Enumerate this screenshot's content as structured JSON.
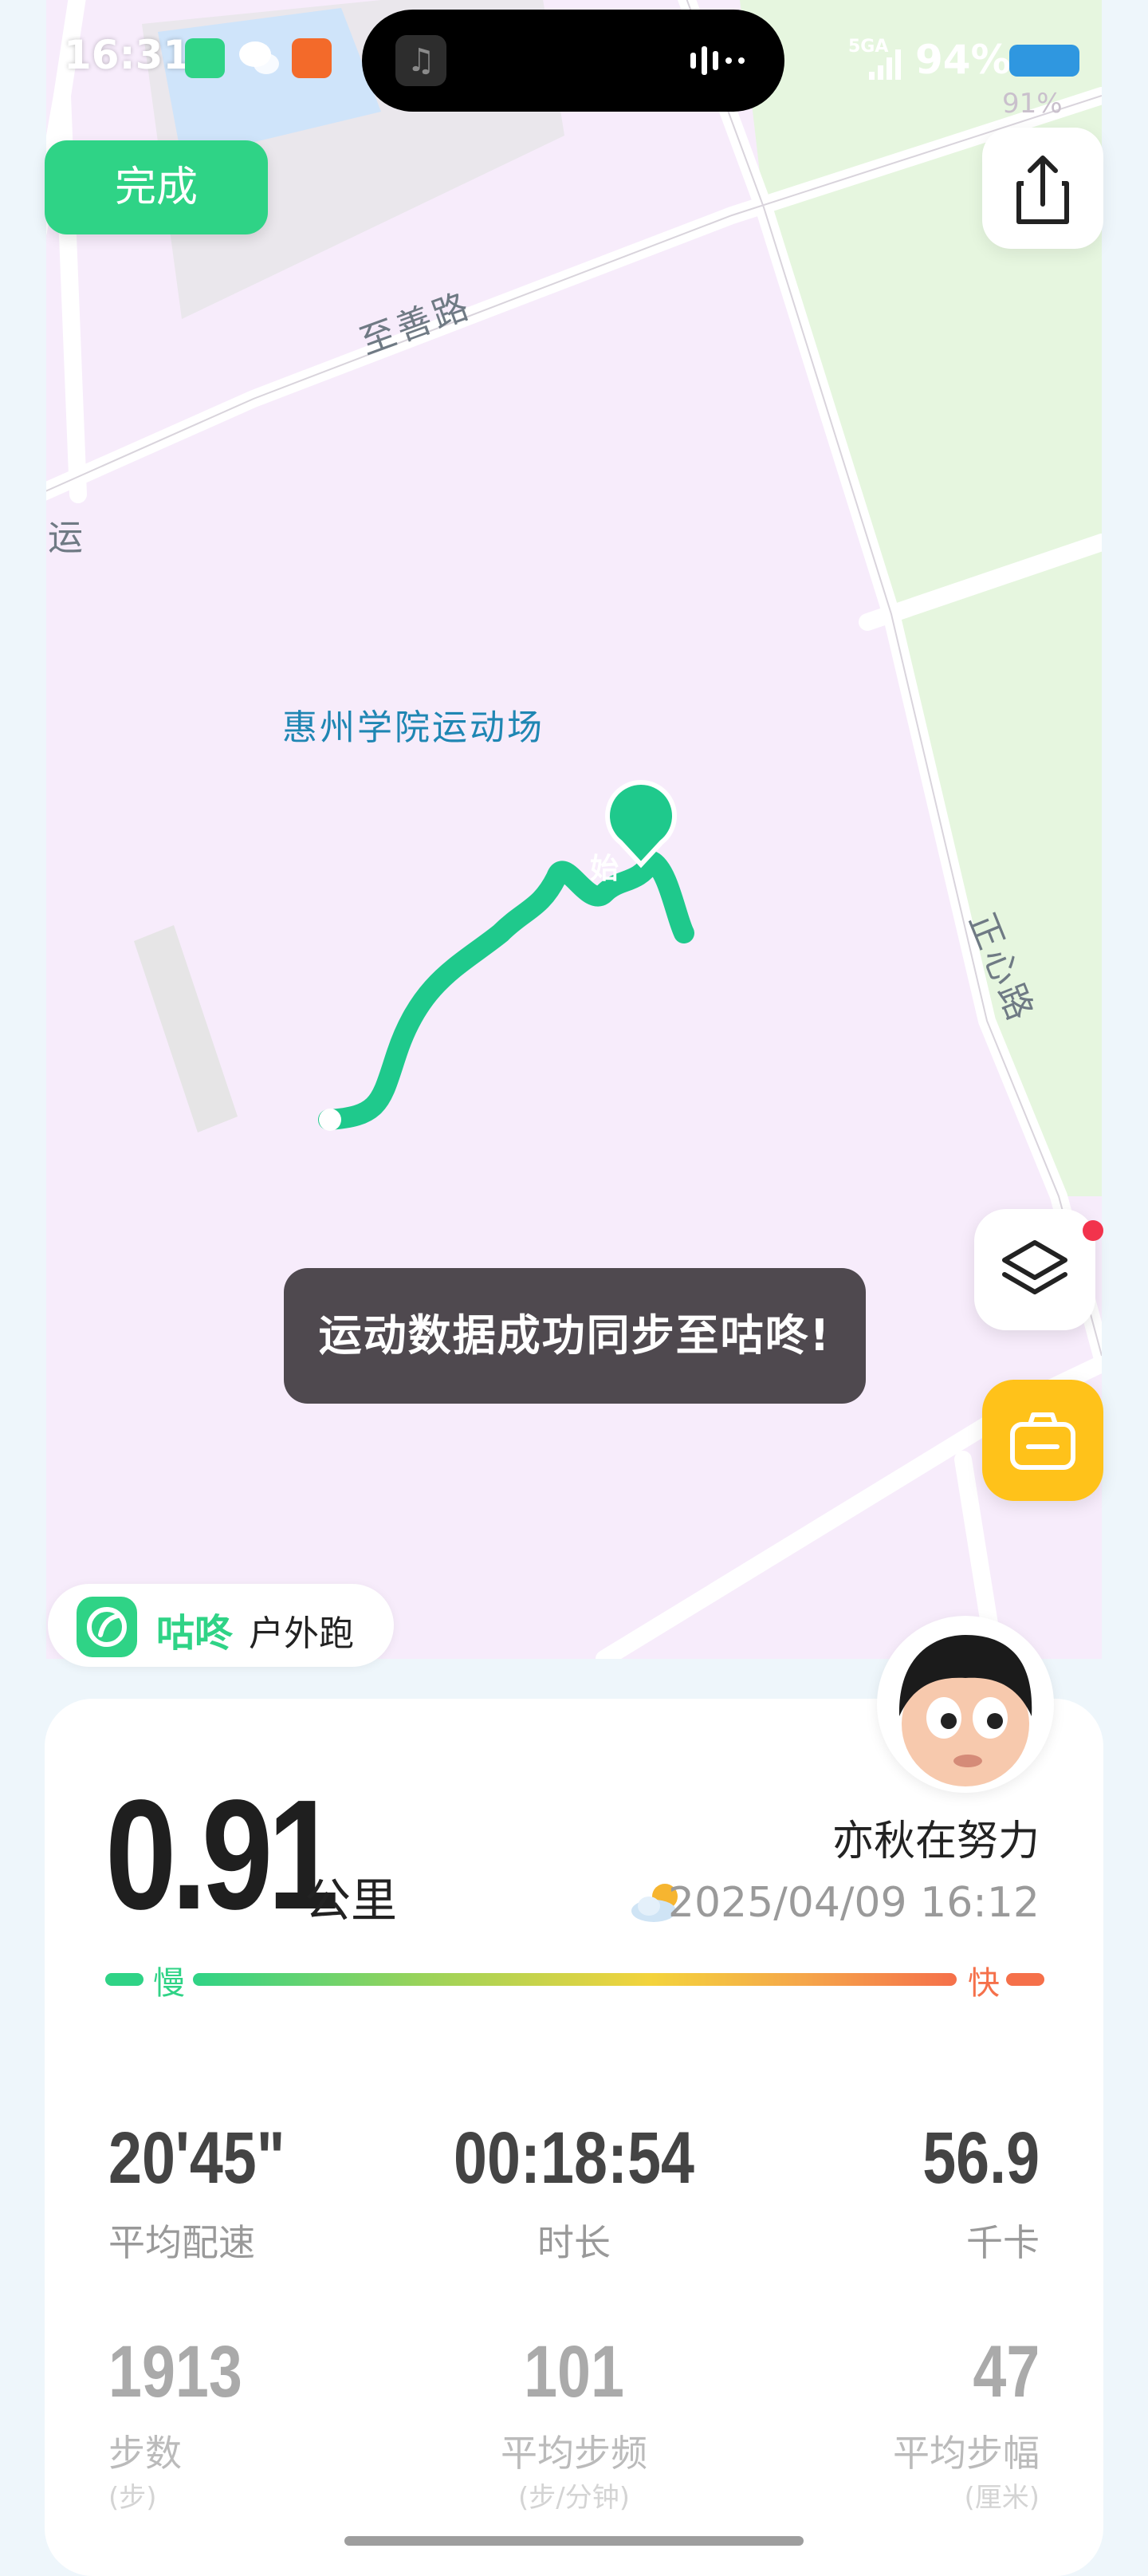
{
  "status_bar": {
    "time": "16:31",
    "network": "5GA",
    "battery": "94%",
    "map_battery_overlay": "91%"
  },
  "map": {
    "road_1": "至善路",
    "road_2": "正心路",
    "road_3": "运",
    "poi": "惠州学院运动场",
    "start_marker": "始"
  },
  "buttons": {
    "done": "完成"
  },
  "toast": "运动数据成功同步至咕咚!",
  "brand": {
    "name": "咕咚",
    "activity": "户外跑"
  },
  "summary": {
    "distance": "0.91",
    "distance_unit": "公里",
    "username": "亦秋在努力",
    "datetime": "2025/04/09 16:12",
    "pace_slow": "慢",
    "pace_fast": "快"
  },
  "stats": {
    "row1": [
      {
        "value": "20'45\"",
        "label": "平均配速"
      },
      {
        "value": "00:18:54",
        "label": "时长"
      },
      {
        "value": "56.9",
        "label": "千卡"
      }
    ],
    "row2": [
      {
        "value": "1913",
        "label": "步数",
        "unit": "(步)"
      },
      {
        "value": "101",
        "label": "平均步频",
        "unit": "(步/分钟)"
      },
      {
        "value": "47",
        "label": "平均步幅",
        "unit": "(厘米)"
      }
    ]
  },
  "colors": {
    "brand_green": "#2fd386",
    "camera_yellow": "#ffc21a",
    "pace_fast": "#f5704a"
  }
}
